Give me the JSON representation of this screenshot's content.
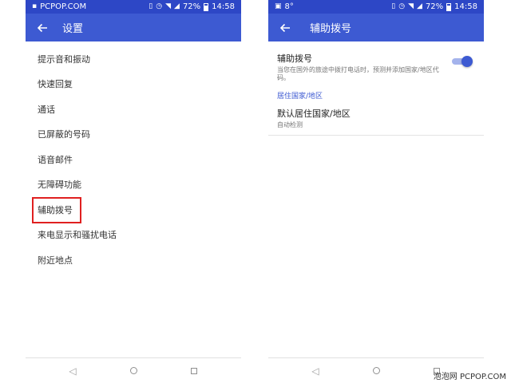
{
  "left": {
    "status": {
      "carrier": "PCPOP.COM",
      "battery": "72%",
      "time": "14:58"
    },
    "title": "设置",
    "menu": [
      "提示音和振动",
      "快速回复",
      "通话",
      "已屏蔽的号码",
      "语音邮件",
      "无障碍功能",
      "辅助拨号",
      "来电显示和骚扰电话",
      "附近地点"
    ]
  },
  "right": {
    "status": {
      "temp": "8°",
      "battery": "72%",
      "time": "14:58"
    },
    "title": "辅助拨号",
    "assisted": {
      "title": "辅助拨号",
      "summary": "当您在国外的旅途中拨打电话时，预测并添加国家/地区代码。",
      "enabled": true
    },
    "section": "居住国家/地区",
    "home_country": {
      "title": "默认居住国家/地区",
      "summary": "自动检测"
    }
  },
  "nav": {
    "back": "◁"
  },
  "watermark": "泡泡网 PCPOP.COM",
  "colors": {
    "status": "#2d47c6",
    "appbar": "#3d5ad2",
    "highlight": "#e02020"
  }
}
